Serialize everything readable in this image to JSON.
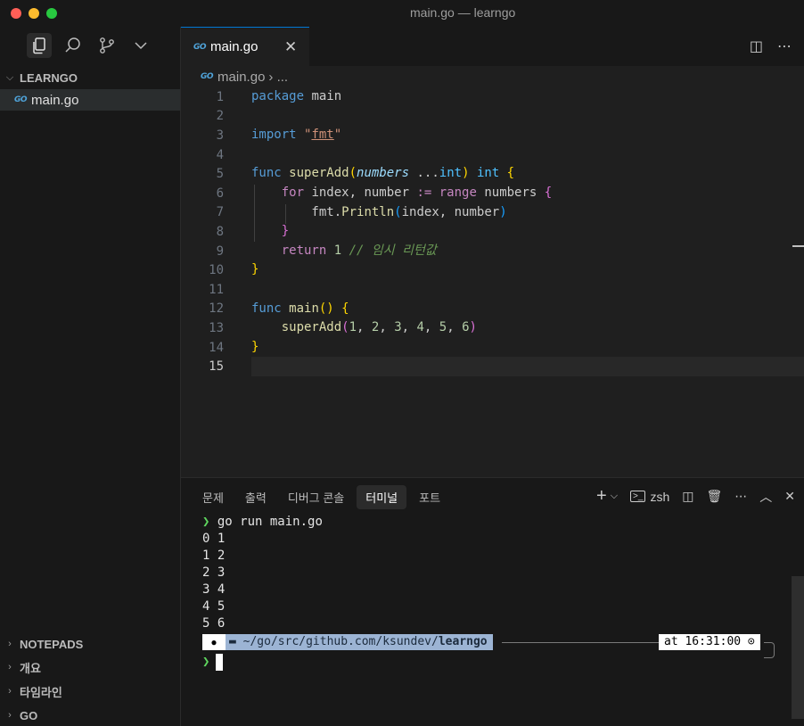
{
  "window": {
    "title": "main.go — learngo"
  },
  "activity": {
    "icons": [
      "files-icon",
      "search-icon",
      "source-control-icon",
      "chevron-down-icon"
    ]
  },
  "explorer": {
    "section_title": "LEARNGO",
    "file_badge": "GO",
    "file_name": "main.go",
    "bottom_sections": [
      "NOTEPADS",
      "개요",
      "타임라인",
      "GO"
    ]
  },
  "editor": {
    "tab_label": "main.go",
    "breadcrumb_file": "main.go",
    "breadcrumb_rest": "› ...",
    "lines": [
      "1",
      "2",
      "3",
      "4",
      "5",
      "6",
      "7",
      "8",
      "9",
      "10",
      "11",
      "12",
      "13",
      "14",
      "15"
    ],
    "active_line": "15"
  },
  "panel": {
    "tabs": [
      "문제",
      "출력",
      "디버그 콘솔",
      "터미널",
      "포트"
    ],
    "selected_tab": "터미널",
    "shell_label": "zsh"
  },
  "terminal": {
    "command": "go run main.go",
    "output": [
      "0 1",
      "1 2",
      "2 3",
      "3 4",
      "4 5",
      "5 6"
    ],
    "path_prefix": "~/go/src/github.com/ksundev/",
    "path_dir": "learngo",
    "time": "at 16:31:00"
  }
}
